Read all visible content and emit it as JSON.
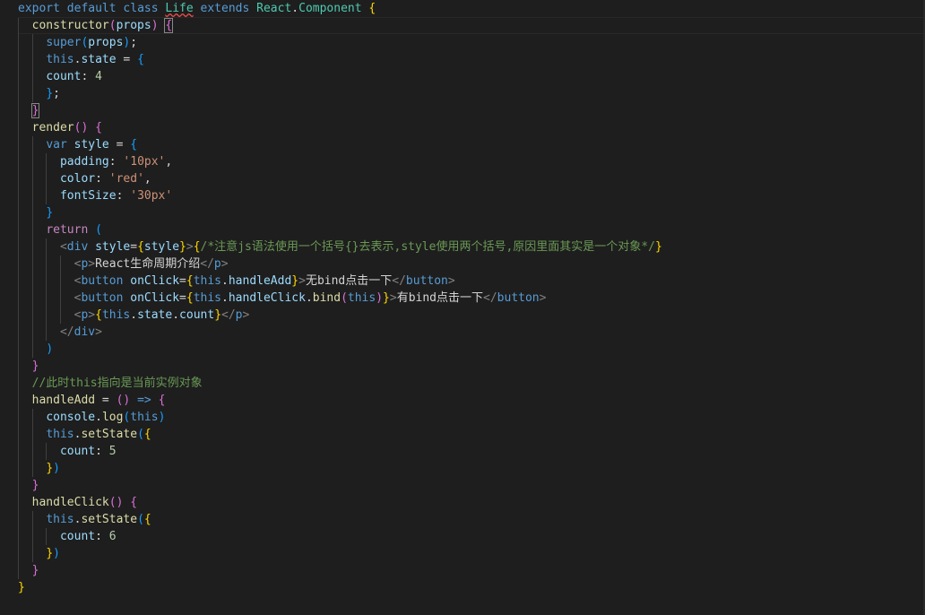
{
  "editor": {
    "language": "javascript-react",
    "theme_background": "#1e1e1e"
  },
  "lines": [
    [
      [
        "kw",
        "export"
      ],
      [
        "txt",
        " "
      ],
      [
        "kw",
        "default"
      ],
      [
        "txt",
        " "
      ],
      [
        "kw",
        "class"
      ],
      [
        "txt",
        " "
      ],
      [
        "cls",
        "Life"
      ],
      [
        "txt",
        " "
      ],
      [
        "kw",
        "extends"
      ],
      [
        "txt",
        " "
      ],
      [
        "cls",
        "React"
      ],
      [
        "txt",
        "."
      ],
      [
        "cls",
        "Component"
      ],
      [
        "txt",
        " "
      ],
      [
        "b1",
        "{"
      ]
    ],
    [
      [
        "txt",
        "  "
      ],
      [
        "fn",
        "constructor"
      ],
      [
        "b2",
        "("
      ],
      [
        "var",
        "props"
      ],
      [
        "b2",
        ")"
      ],
      [
        "txt",
        " "
      ],
      [
        "b2",
        "{"
      ]
    ],
    [
      [
        "txt",
        "    "
      ],
      [
        "kw",
        "super"
      ],
      [
        "b3",
        "("
      ],
      [
        "var",
        "props"
      ],
      [
        "b3",
        ")"
      ],
      [
        "txt",
        ";"
      ]
    ],
    [
      [
        "txt",
        "    "
      ],
      [
        "kw",
        "this"
      ],
      [
        "txt",
        "."
      ],
      [
        "var",
        "state"
      ],
      [
        "txt",
        " = "
      ],
      [
        "b3",
        "{"
      ]
    ],
    [
      [
        "txt",
        "    "
      ],
      [
        "var",
        "count"
      ],
      [
        "txt",
        ": "
      ],
      [
        "num",
        "4"
      ]
    ],
    [
      [
        "txt",
        "    "
      ],
      [
        "b3",
        "}"
      ],
      [
        "txt",
        ";"
      ]
    ],
    [
      [
        "txt",
        "  "
      ],
      [
        "b2",
        "}"
      ]
    ],
    [
      [
        "txt",
        "  "
      ],
      [
        "fn",
        "render"
      ],
      [
        "b2",
        "()"
      ],
      [
        "txt",
        " "
      ],
      [
        "b2",
        "{"
      ]
    ],
    [
      [
        "txt",
        "    "
      ],
      [
        "kw",
        "var"
      ],
      [
        "txt",
        " "
      ],
      [
        "var",
        "style"
      ],
      [
        "txt",
        " = "
      ],
      [
        "b3",
        "{"
      ]
    ],
    [
      [
        "txt",
        "      "
      ],
      [
        "var",
        "padding"
      ],
      [
        "txt",
        ": "
      ],
      [
        "str",
        "'10px'"
      ],
      [
        "txt",
        ","
      ]
    ],
    [
      [
        "txt",
        "      "
      ],
      [
        "var",
        "color"
      ],
      [
        "txt",
        ": "
      ],
      [
        "str",
        "'red'"
      ],
      [
        "txt",
        ","
      ]
    ],
    [
      [
        "txt",
        "      "
      ],
      [
        "var",
        "fontSize"
      ],
      [
        "txt",
        ": "
      ],
      [
        "str",
        "'30px'"
      ]
    ],
    [
      [
        "txt",
        "    "
      ],
      [
        "b3",
        "}"
      ]
    ],
    [
      [
        "txt",
        "    "
      ],
      [
        "ctrl",
        "return"
      ],
      [
        "txt",
        " "
      ],
      [
        "b3",
        "("
      ]
    ],
    [
      [
        "txt",
        "      "
      ],
      [
        "punc",
        "<"
      ],
      [
        "tag",
        "div"
      ],
      [
        "txt",
        " "
      ],
      [
        "var",
        "style"
      ],
      [
        "txt",
        "="
      ],
      [
        "b1",
        "{"
      ],
      [
        "var",
        "style"
      ],
      [
        "b1",
        "}"
      ],
      [
        "punc",
        ">"
      ],
      [
        "b1",
        "{"
      ],
      [
        "cmt",
        "/*注意js语法使用一个括号{}去表示,style使用两个括号,原因里面其实是一个对象*/"
      ],
      [
        "b1",
        "}"
      ]
    ],
    [
      [
        "txt",
        "        "
      ],
      [
        "punc",
        "<"
      ],
      [
        "tag",
        "p"
      ],
      [
        "punc",
        ">"
      ],
      [
        "txt",
        "React生命周期介绍"
      ],
      [
        "punc",
        "</"
      ],
      [
        "tag",
        "p"
      ],
      [
        "punc",
        ">"
      ]
    ],
    [
      [
        "txt",
        "        "
      ],
      [
        "punc",
        "<"
      ],
      [
        "tag",
        "button"
      ],
      [
        "txt",
        " "
      ],
      [
        "var",
        "onClick"
      ],
      [
        "txt",
        "="
      ],
      [
        "b1",
        "{"
      ],
      [
        "kw",
        "this"
      ],
      [
        "txt",
        "."
      ],
      [
        "var",
        "handleAdd"
      ],
      [
        "b1",
        "}"
      ],
      [
        "punc",
        ">"
      ],
      [
        "txt",
        "无bind点击一下"
      ],
      [
        "punc",
        "</"
      ],
      [
        "tag",
        "button"
      ],
      [
        "punc",
        ">"
      ]
    ],
    [
      [
        "txt",
        "        "
      ],
      [
        "punc",
        "<"
      ],
      [
        "tag",
        "button"
      ],
      [
        "txt",
        " "
      ],
      [
        "var",
        "onClick"
      ],
      [
        "txt",
        "="
      ],
      [
        "b1",
        "{"
      ],
      [
        "kw",
        "this"
      ],
      [
        "txt",
        "."
      ],
      [
        "var",
        "handleClick"
      ],
      [
        "txt",
        "."
      ],
      [
        "fn",
        "bind"
      ],
      [
        "b2",
        "("
      ],
      [
        "kw",
        "this"
      ],
      [
        "b2",
        ")"
      ],
      [
        "b1",
        "}"
      ],
      [
        "punc",
        ">"
      ],
      [
        "txt",
        "有bind点击一下"
      ],
      [
        "punc",
        "</"
      ],
      [
        "tag",
        "button"
      ],
      [
        "punc",
        ">"
      ]
    ],
    [
      [
        "txt",
        "        "
      ],
      [
        "punc",
        "<"
      ],
      [
        "tag",
        "p"
      ],
      [
        "punc",
        ">"
      ],
      [
        "b1",
        "{"
      ],
      [
        "kw",
        "this"
      ],
      [
        "txt",
        "."
      ],
      [
        "var",
        "state"
      ],
      [
        "txt",
        "."
      ],
      [
        "var",
        "count"
      ],
      [
        "b1",
        "}"
      ],
      [
        "punc",
        "</"
      ],
      [
        "tag",
        "p"
      ],
      [
        "punc",
        ">"
      ]
    ],
    [
      [
        "txt",
        "      "
      ],
      [
        "punc",
        "</"
      ],
      [
        "tag",
        "div"
      ],
      [
        "punc",
        ">"
      ]
    ],
    [
      [
        "txt",
        "    "
      ],
      [
        "b3",
        ")"
      ]
    ],
    [
      [
        "txt",
        "  "
      ],
      [
        "b2",
        "}"
      ]
    ],
    [
      [
        "txt",
        "  "
      ],
      [
        "cmt",
        "//此时this指向是当前实例对象"
      ]
    ],
    [
      [
        "txt",
        "  "
      ],
      [
        "fn",
        "handleAdd"
      ],
      [
        "txt",
        " = "
      ],
      [
        "b2",
        "()"
      ],
      [
        "txt",
        " "
      ],
      [
        "kw",
        "=>"
      ],
      [
        "txt",
        " "
      ],
      [
        "b2",
        "{"
      ]
    ],
    [
      [
        "txt",
        "    "
      ],
      [
        "var",
        "console"
      ],
      [
        "txt",
        "."
      ],
      [
        "fn",
        "log"
      ],
      [
        "b3",
        "("
      ],
      [
        "kw",
        "this"
      ],
      [
        "b3",
        ")"
      ]
    ],
    [
      [
        "txt",
        "    "
      ],
      [
        "kw",
        "this"
      ],
      [
        "txt",
        "."
      ],
      [
        "fn",
        "setState"
      ],
      [
        "b3",
        "("
      ],
      [
        "b1",
        "{"
      ]
    ],
    [
      [
        "txt",
        "      "
      ],
      [
        "var",
        "count"
      ],
      [
        "txt",
        ": "
      ],
      [
        "num",
        "5"
      ]
    ],
    [
      [
        "txt",
        "    "
      ],
      [
        "b1",
        "}"
      ],
      [
        "b3",
        ")"
      ]
    ],
    [
      [
        "txt",
        "  "
      ],
      [
        "b2",
        "}"
      ]
    ],
    [
      [
        "txt",
        "  "
      ],
      [
        "fn",
        "handleClick"
      ],
      [
        "b2",
        "()"
      ],
      [
        "txt",
        " "
      ],
      [
        "b2",
        "{"
      ]
    ],
    [
      [
        "txt",
        "    "
      ],
      [
        "kw",
        "this"
      ],
      [
        "txt",
        "."
      ],
      [
        "fn",
        "setState"
      ],
      [
        "b3",
        "("
      ],
      [
        "b1",
        "{"
      ]
    ],
    [
      [
        "txt",
        "      "
      ],
      [
        "var",
        "count"
      ],
      [
        "txt",
        ": "
      ],
      [
        "num",
        "6"
      ]
    ],
    [
      [
        "txt",
        "    "
      ],
      [
        "b1",
        "}"
      ],
      [
        "b3",
        ")"
      ]
    ],
    [
      [
        "txt",
        "  "
      ],
      [
        "b2",
        "}"
      ]
    ],
    [
      [
        "b1",
        "}"
      ]
    ]
  ]
}
